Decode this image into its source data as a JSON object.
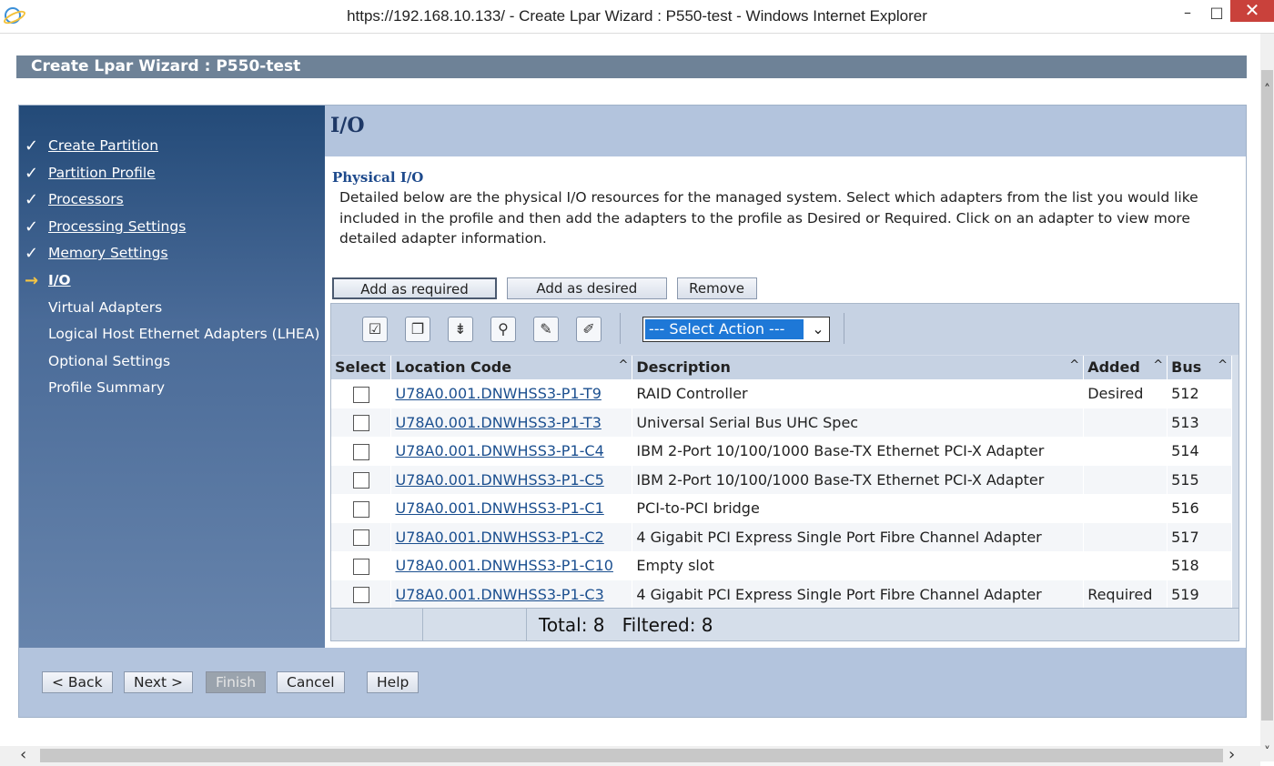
{
  "window": {
    "title": "https://192.168.10.133/ - Create Lpar Wizard : P550-test - Windows Internet Explorer",
    "minimize": "–",
    "maximize": "□",
    "close": "✕"
  },
  "header": {
    "title": "Create Lpar Wizard : P550-test"
  },
  "nav": {
    "items": [
      {
        "label": "Create Partition",
        "state": "done",
        "mark": "✓"
      },
      {
        "label": "Partition Profile",
        "state": "done",
        "mark": "✓"
      },
      {
        "label": "Processors",
        "state": "done",
        "mark": "✓"
      },
      {
        "label": "Processing Settings",
        "state": "done",
        "mark": "✓"
      },
      {
        "label": "Memory Settings",
        "state": "done",
        "mark": "✓"
      },
      {
        "label": "I/O",
        "state": "current",
        "mark": "→"
      },
      {
        "label": "Virtual Adapters",
        "state": "todo",
        "mark": ""
      },
      {
        "label": "Logical Host Ethernet Adapters (LHEA)",
        "state": "todo",
        "mark": ""
      },
      {
        "label": "Optional Settings",
        "state": "todo",
        "mark": ""
      },
      {
        "label": "Profile Summary",
        "state": "todo",
        "mark": ""
      }
    ]
  },
  "main": {
    "title": "I/O",
    "section_head": "Physical I/O",
    "description": "Detailed below are the physical I/O resources for the managed system. Select which adapters from the list you would like included in the profile and then add the adapters to the profile as Desired or Required. Click on an adapter to view more detailed adapter information.",
    "buttons": {
      "add_required": "Add as required",
      "add_desired": "Add as desired",
      "remove": "Remove"
    },
    "toolbar": {
      "icons": [
        "select-all-icon",
        "deselect-all-icon",
        "show-filter-row-icon",
        "clear-all-filters-icon",
        "edit-sort-icon",
        "clear-all-sorts-icon"
      ],
      "select_action": "--- Select Action ---",
      "arrow": "⌄"
    },
    "table": {
      "columns": [
        "Select",
        "Location Code",
        "Description",
        "Added",
        "Bus"
      ],
      "sort_glyph": "^",
      "rows": [
        {
          "location": "U78A0.001.DNWHSS3-P1-T9",
          "description": "RAID Controller",
          "added": "Desired",
          "bus": "512"
        },
        {
          "location": "U78A0.001.DNWHSS3-P1-T3",
          "description": "Universal Serial Bus UHC Spec",
          "added": "",
          "bus": "513"
        },
        {
          "location": "U78A0.001.DNWHSS3-P1-C4",
          "description": "IBM 2-Port 10/100/1000 Base-TX Ethernet PCI-X Adapter",
          "added": "",
          "bus": "514"
        },
        {
          "location": "U78A0.001.DNWHSS3-P1-C5",
          "description": "IBM 2-Port 10/100/1000 Base-TX Ethernet PCI-X Adapter",
          "added": "",
          "bus": "515"
        },
        {
          "location": "U78A0.001.DNWHSS3-P1-C1",
          "description": "PCI-to-PCI bridge",
          "added": "",
          "bus": "516"
        },
        {
          "location": "U78A0.001.DNWHSS3-P1-C2",
          "description": "4 Gigabit PCI Express Single Port Fibre Channel Adapter",
          "added": "",
          "bus": "517"
        },
        {
          "location": "U78A0.001.DNWHSS3-P1-C10",
          "description": "Empty slot",
          "added": "",
          "bus": "518"
        },
        {
          "location": "U78A0.001.DNWHSS3-P1-C3",
          "description": "4 Gigabit PCI Express Single Port Fibre Channel Adapter",
          "added": "Required",
          "bus": "519"
        }
      ],
      "footer": "Total: 8   Filtered: 8"
    }
  },
  "footer_buttons": {
    "back": "< Back",
    "next": "Next >",
    "finish": "Finish",
    "cancel": "Cancel",
    "help": "Help"
  }
}
